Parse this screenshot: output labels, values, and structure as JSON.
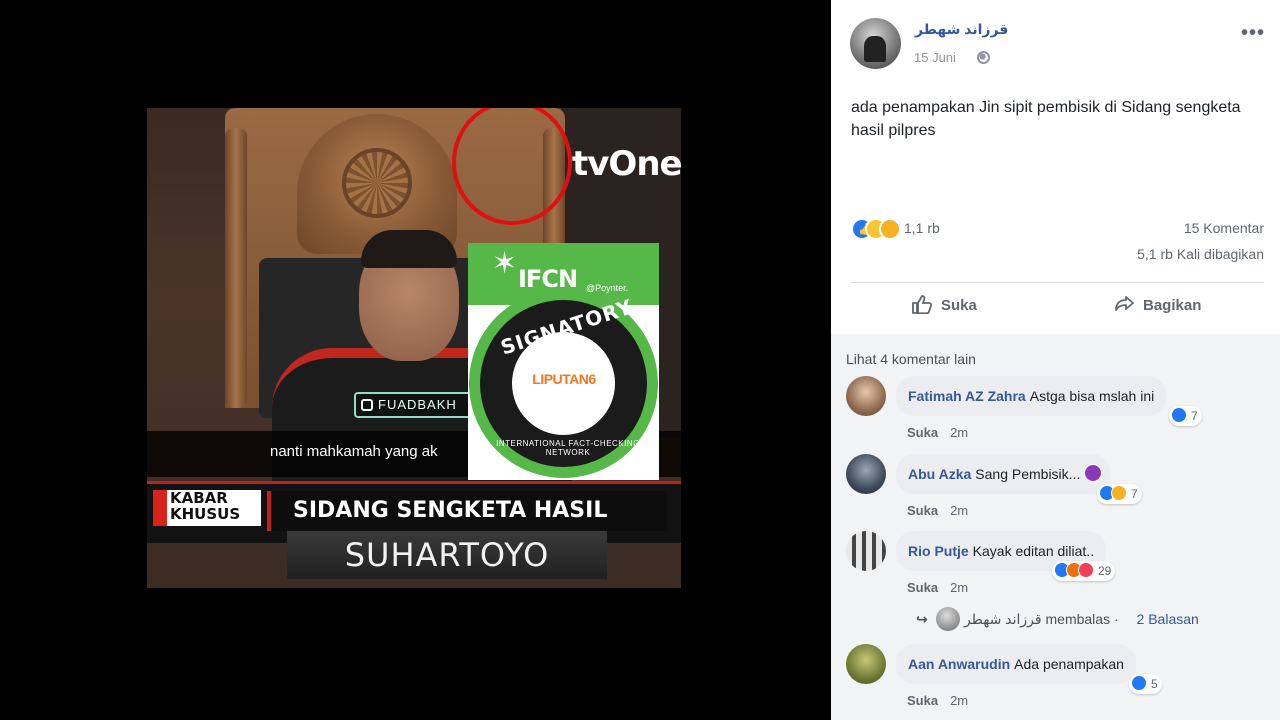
{
  "photo": {
    "channel_logo": "tvOne",
    "watermark": "FUADBAKH",
    "subtitle": "nanti mahkamah yang ak",
    "kabar_top": "KABAR",
    "kabar_bottom": "KHUSUS",
    "headline": "SIDANG SENGKETA HASIL PILPRES",
    "nameplate": "SUHARTOYO"
  },
  "badge": {
    "ifcn": "IFCN",
    "poynter": "@Poynter.",
    "signatory": "SIGNATORY",
    "publisher": "LIPUTAN6",
    "network": "INTERNATIONAL FACT-CHECKING NETWORK"
  },
  "post": {
    "author": "قرزاند شهطر",
    "date": "15 Juni",
    "text": "ada penampakan Jin sipit pembisik di Sidang sengketa hasil pilpres",
    "reaction_count": "1,1 rb",
    "comment_count": "15 Komentar",
    "share_count": "5,1 rb Kali dibagikan",
    "like_label": "Suka",
    "share_label": "Bagikan"
  },
  "comments_section": {
    "more_label": "Lihat 4 komentar lain",
    "comments": [
      {
        "name": "Fatimah AZ Zahra",
        "text": "Astga bisa mslah ini",
        "like": "Suka",
        "time": "2m",
        "reaction_count": "7"
      },
      {
        "name": "Abu Azka",
        "text": "Sang Pembisik...",
        "like": "Suka",
        "time": "2m",
        "reaction_count": "7"
      },
      {
        "name": "Rio Putje",
        "text": "Kayak editan diliat..",
        "like": "Suka",
        "time": "2m",
        "reaction_count": "29"
      },
      {
        "name": "Aan Anwarudin",
        "text": "Ada penampakan",
        "like": "Suka",
        "time": "2m",
        "reaction_count": "5"
      }
    ],
    "reply": {
      "author": "قرزاند شهطر",
      "action": "membalas",
      "count": "2 Balasan"
    }
  },
  "colors": {
    "link": "#385898",
    "like_blue": "#2078f4",
    "ifcn_green": "#55b848",
    "tvone_red": "#e62d1a"
  }
}
